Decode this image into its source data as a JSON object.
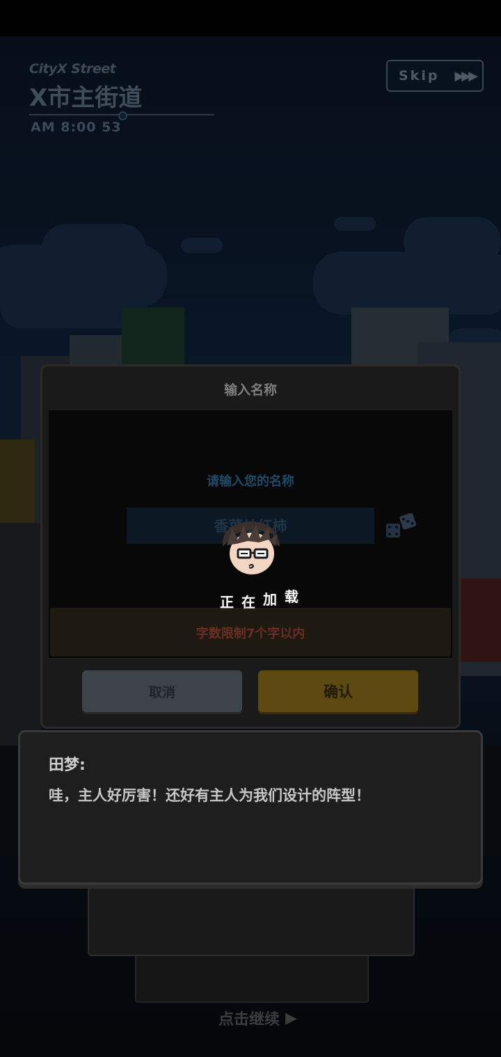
{
  "location": {
    "english": "CityX Street",
    "chinese": "X市主街道",
    "time": "AM 8:00 53"
  },
  "skip": {
    "label": "Skip",
    "icon": "fast-forward-icon"
  },
  "modal": {
    "title": "输入名称",
    "prompt": "请输入您的名称",
    "name_value": "香菜炒红柿",
    "random_icon": "dice-icon",
    "limit_hint": "字数限制7个字以内",
    "cancel_label": "取消",
    "confirm_label": "确认"
  },
  "loading": {
    "text": [
      "正",
      "在",
      "加",
      "载"
    ],
    "avatar_icon": "avatar-glasses-icon"
  },
  "dialog": {
    "speaker": "田梦:",
    "text": "哇，主人好厉害！还好有主人为我们设计的阵型！",
    "continue_label": "点击继续",
    "continue_icon": "play-triangle-icon"
  },
  "colors": {
    "confirm": "#5e4a10",
    "cancel": "#3e434a",
    "limit_text": "#6a2e24",
    "prompt": "#1e4a68"
  }
}
